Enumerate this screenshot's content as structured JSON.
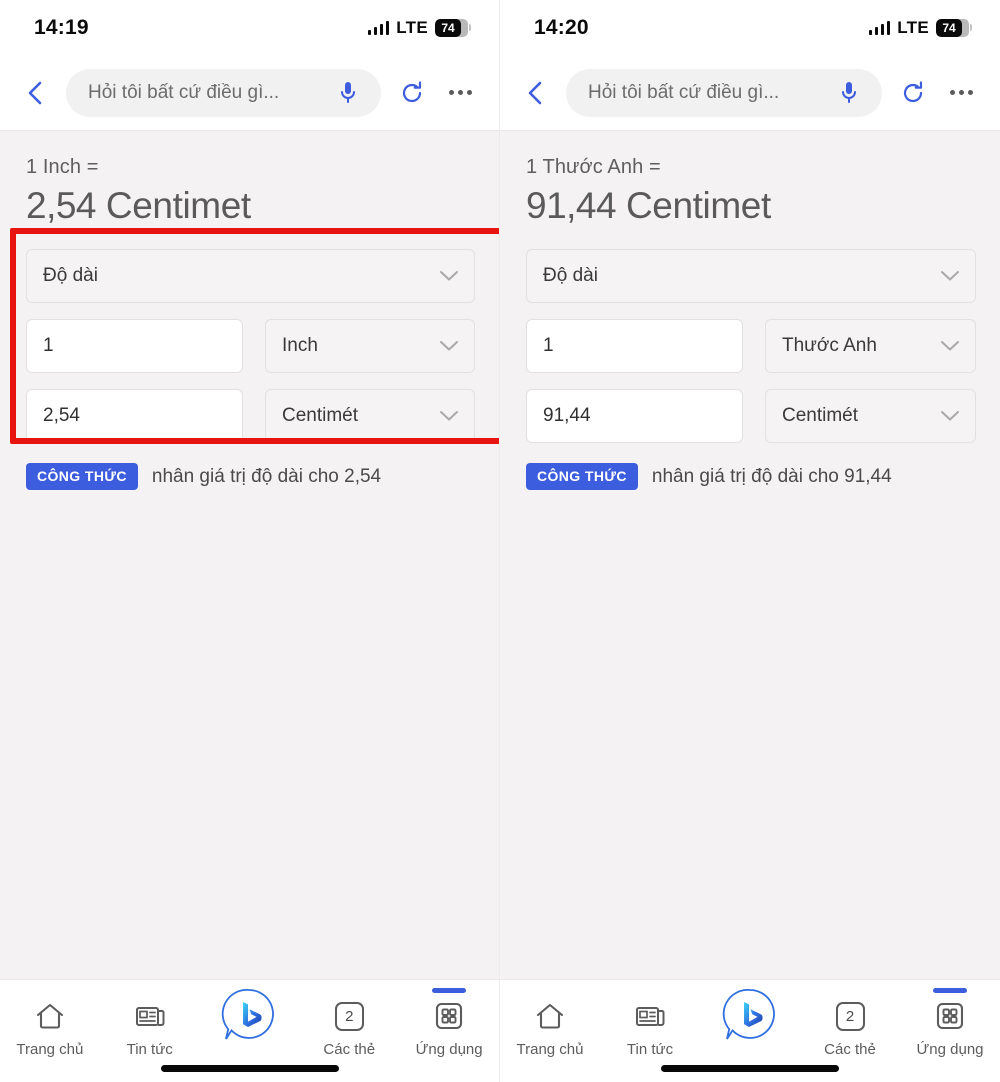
{
  "panels": [
    {
      "id": "left",
      "status": {
        "time": "14:19",
        "network": "LTE",
        "battery_level": "74",
        "signal_icon": "signal-bars-icon",
        "battery_icon": "battery-icon"
      },
      "toolbar": {
        "back_icon": "chevron-left-icon",
        "search_placeholder": "Hỏi tôi bất cứ điều gì...",
        "mic_icon": "microphone-icon",
        "refresh_icon": "refresh-icon",
        "more_icon": "more-options-icon"
      },
      "result": {
        "equation": "1 Inch =",
        "value": "2,54",
        "unit": "Centimet"
      },
      "converter": {
        "category_label": "Độ dài",
        "from_value": "1",
        "from_unit": "Inch",
        "to_value": "2,54",
        "to_unit": "Centimét",
        "chevron_icon": "chevron-down-icon"
      },
      "formula": {
        "badge": "CÔNG THỨC",
        "text": "nhân giá trị độ dài cho 2,54"
      },
      "annotation": {
        "visible": true,
        "color": "#e8140f"
      },
      "nav": [
        {
          "label": "Trang chủ",
          "icon": "home-icon",
          "active": false
        },
        {
          "label": "Tin tức",
          "icon": "news-icon",
          "active": false
        },
        {
          "label": "",
          "icon": "bing-chat-icon",
          "active": false
        },
        {
          "label": "Các thẻ",
          "icon": "tabs-icon",
          "count": "2",
          "active": false
        },
        {
          "label": "Ứng dụng",
          "icon": "apps-grid-icon",
          "active": true
        }
      ]
    },
    {
      "id": "right",
      "status": {
        "time": "14:20",
        "network": "LTE",
        "battery_level": "74",
        "signal_icon": "signal-bars-icon",
        "battery_icon": "battery-icon"
      },
      "toolbar": {
        "back_icon": "chevron-left-icon",
        "search_placeholder": "Hỏi tôi bất cứ điều gì...",
        "mic_icon": "microphone-icon",
        "refresh_icon": "refresh-icon",
        "more_icon": "more-options-icon"
      },
      "result": {
        "equation": "1 Thước Anh =",
        "value": "91,44",
        "unit": "Centimet"
      },
      "converter": {
        "category_label": "Độ dài",
        "from_value": "1",
        "from_unit": "Thước Anh",
        "to_value": "91,44",
        "to_unit": "Centimét",
        "chevron_icon": "chevron-down-icon"
      },
      "formula": {
        "badge": "CÔNG THỨC",
        "text": "nhân giá trị độ dài cho 91,44"
      },
      "annotation": {
        "visible": false,
        "color": "#e8140f"
      },
      "nav": [
        {
          "label": "Trang chủ",
          "icon": "home-icon",
          "active": false
        },
        {
          "label": "Tin tức",
          "icon": "news-icon",
          "active": false
        },
        {
          "label": "",
          "icon": "bing-chat-icon",
          "active": false
        },
        {
          "label": "Các thẻ",
          "icon": "tabs-icon",
          "count": "2",
          "active": false
        },
        {
          "label": "Ứng dụng",
          "icon": "apps-grid-icon",
          "active": true
        }
      ]
    }
  ],
  "colors": {
    "accent": "#3d5ddf",
    "annotation": "#e8140f",
    "text": "#5a5a5a"
  }
}
